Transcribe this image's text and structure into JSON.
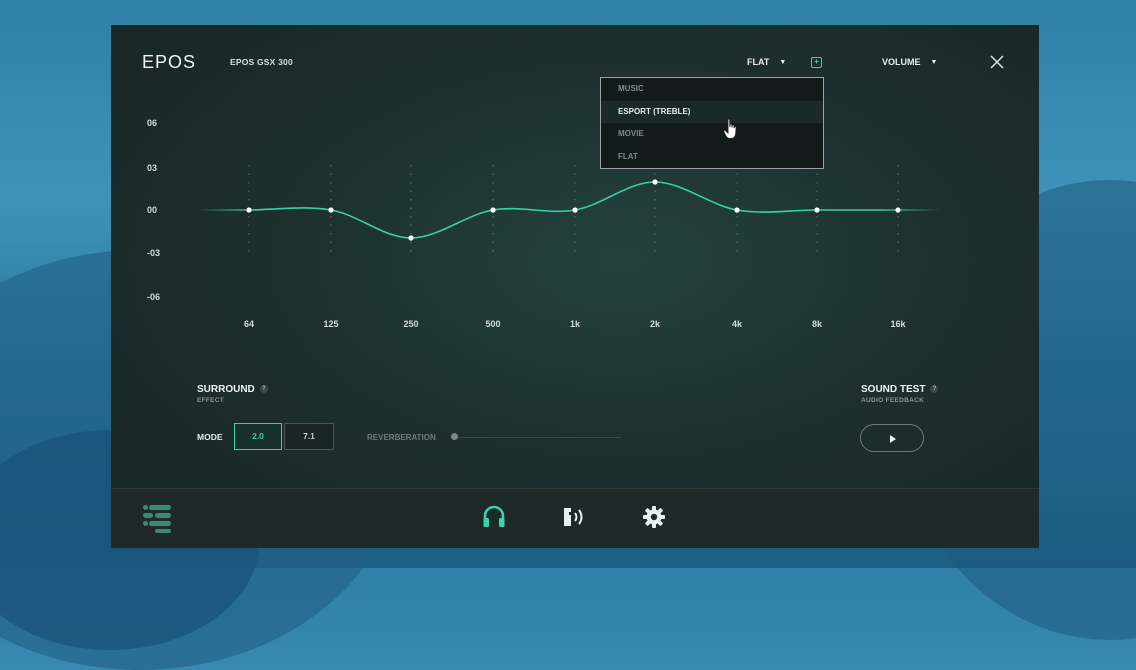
{
  "app": {
    "brand": "EPOS",
    "device": "EPOS GSX 300"
  },
  "header": {
    "preset_value": "FLAT",
    "volume_label": "VOLUME"
  },
  "preset_dropdown": {
    "options": [
      "MUSIC",
      "ESPORT (TREBLE)",
      "MOVIE",
      "FLAT"
    ],
    "highlighted": "ESPORT (TREBLE)"
  },
  "equalizer": {
    "y_labels": [
      "06",
      "03",
      "00",
      "-03",
      "-06"
    ],
    "bands": [
      "64",
      "125",
      "250",
      "500",
      "1k",
      "2k",
      "4k",
      "8k",
      "16k"
    ],
    "gains_db": [
      0,
      0,
      -3,
      0,
      0,
      3,
      0,
      0,
      0
    ],
    "curve_color": "#35d0ac"
  },
  "surround": {
    "title": "SURROUND",
    "subtitle": "EFFECT",
    "mode_label": "MODE",
    "modes": [
      "2.0",
      "7.1"
    ],
    "selected_mode": "2.0",
    "reverb_label": "REVERBERATION",
    "reverb_level": 0
  },
  "sound_test": {
    "title": "SOUND TEST",
    "subtitle": "AUDIO FEEDBACK"
  },
  "help_glyph": "?",
  "icons": {
    "close": "close-icon",
    "add": "plus-icon",
    "menu": "menu-icon",
    "headphones": "headphones-icon",
    "sidetone": "microphone-sidetone-icon",
    "settings": "gear-icon",
    "play": "play-icon"
  },
  "colors": {
    "accent": "#35d0ac",
    "panel": "#1d302f"
  }
}
